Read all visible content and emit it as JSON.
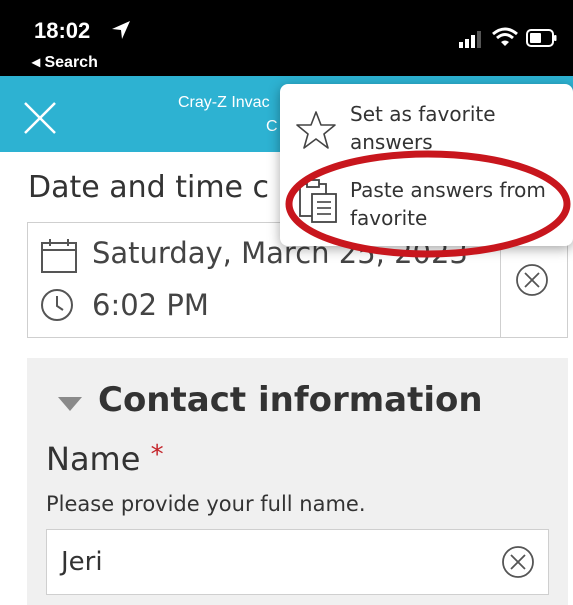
{
  "status_bar": {
    "time": "18:02",
    "back_label": "◂ Search",
    "icons": [
      "location-arrow-icon",
      "cellular-signal-icon",
      "wifi-icon",
      "battery-icon"
    ]
  },
  "header": {
    "title_partial": "Cray-Z Invac",
    "subtitle_partial": "C",
    "background_color": "#2db2d2",
    "close_icon": "close-icon"
  },
  "date_question": {
    "label_partial": "Date and time c",
    "date_value": "Saturday, March 25, 2023",
    "time_value": "6:02 PM",
    "icons": [
      "calendar-icon",
      "clock-icon",
      "clear-icon"
    ]
  },
  "contact_group": {
    "title": "Contact information",
    "caret_icon": "caret-down-icon",
    "name_label": "Name",
    "required_mark": "*",
    "name_hint": "Please provide your full name.",
    "name_value": "Jeri",
    "clear_icon": "clear-icon",
    "required_color": "#c4242a"
  },
  "popup_menu": {
    "items": [
      {
        "label_line1": "Set as favorite",
        "label_line2": "answers",
        "icon": "star-icon"
      },
      {
        "label_line1": "Paste answers from",
        "label_line2": "favorite",
        "icon": "clipboard-icon"
      }
    ],
    "highlight_color": "#c8161d"
  }
}
